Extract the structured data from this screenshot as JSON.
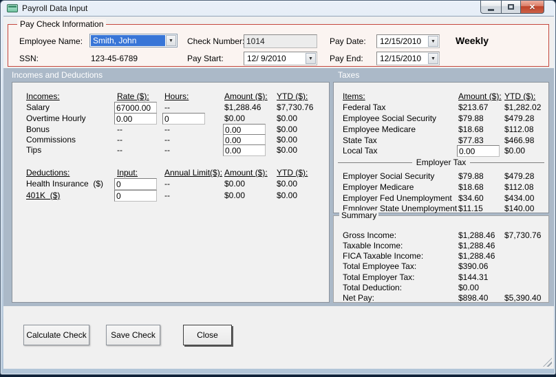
{
  "window": {
    "title": "Payroll Data Input"
  },
  "icons": {
    "close": "✕",
    "dropdown": "▼"
  },
  "colors": {
    "titlebar": "#C9D8E8",
    "band": "#ABB9C8",
    "panel": "#F1F1F1",
    "groupbox_border": "#C4453C",
    "groupbox_bg": "#FBF4F1",
    "selection_blue": "#3875D7",
    "close_red": "#BE4229",
    "window_bg": "#F0F0F0"
  },
  "paycheck_info": {
    "group_label": "Pay Check Information",
    "employee_name_label": "Employee Name:",
    "employee_name_value": "Smith, John",
    "ssn_label": "SSN:",
    "ssn_value": "123-45-6789",
    "check_number_label": "Check Number:",
    "check_number_value": "1014",
    "pay_start_label": "Pay Start:",
    "pay_start_value": "12/ 9/2010",
    "pay_date_label": "Pay Date:",
    "pay_date_value": "12/15/2010",
    "pay_end_label": "Pay End:",
    "pay_end_value": "12/15/2010",
    "frequency": "Weekly"
  },
  "sections": {
    "incomes_deductions_header": "Incomes and Deductions",
    "taxes_header": "Taxes"
  },
  "incomes": {
    "headers": {
      "name": "Incomes:",
      "rate": "Rate ($):",
      "hours": "Hours:",
      "amount": "Amount ($):",
      "ytd": "YTD ($):"
    },
    "rows": [
      {
        "label": "Salary",
        "rate": "67000.00",
        "hours": "--",
        "amount": "$1,288.46",
        "ytd": "$7,730.76"
      },
      {
        "label": "Overtime Hourly",
        "rate": "0.00",
        "hours": "0",
        "amount": "$0.00",
        "ytd": "$0.00"
      },
      {
        "label": "Bonus",
        "rate": "--",
        "hours": "--",
        "amount": "0.00",
        "ytd": "$0.00"
      },
      {
        "label": "Commissions",
        "rate": "--",
        "hours": "--",
        "amount": "0.00",
        "ytd": "$0.00"
      },
      {
        "label": "Tips",
        "rate": "--",
        "hours": "--",
        "amount": "0.00",
        "ytd": "$0.00"
      }
    ]
  },
  "deductions": {
    "headers": {
      "name": "Deductions:",
      "input": "Input:",
      "annual_limit": "Annual Limit($):",
      "amount": "Amount ($):",
      "ytd": "YTD ($):"
    },
    "rows": [
      {
        "label": "Health Insurance  ($)",
        "input": "0",
        "annual_limit": "--",
        "amount": "$0.00",
        "ytd": "$0.00"
      },
      {
        "label": "401K  ($)",
        "input": "0",
        "annual_limit": "--",
        "amount": "$0.00",
        "ytd": "$0.00"
      }
    ]
  },
  "taxes": {
    "headers": {
      "items": "Items:",
      "amount": "Amount ($):",
      "ytd": "YTD ($):"
    },
    "employee_rows": [
      {
        "label": "Federal Tax",
        "amount": "$213.67",
        "ytd": "$1,282.02"
      },
      {
        "label": "Employee Social Security",
        "amount": "$79.88",
        "ytd": "$479.28"
      },
      {
        "label": "Employee Medicare",
        "amount": "$18.68",
        "ytd": "$112.08"
      },
      {
        "label": "State Tax",
        "amount": "$77.83",
        "ytd": "$466.98"
      },
      {
        "label": "Local Tax",
        "amount": "0.00",
        "ytd": "$0.00"
      }
    ],
    "employer_header": "Employer Tax",
    "employer_rows": [
      {
        "label": "Employer Social Security",
        "amount": "$79.88",
        "ytd": "$479.28"
      },
      {
        "label": "Employer Medicare",
        "amount": "$18.68",
        "ytd": "$112.08"
      },
      {
        "label": "Employer Fed Unemployment",
        "amount": "$34.60",
        "ytd": "$434.00"
      },
      {
        "label": "Employer State Unemployment",
        "amount": "$11.15",
        "ytd": "$140.00"
      }
    ]
  },
  "summary": {
    "group_label": "Summary",
    "rows": [
      {
        "label": "Gross Income:",
        "amount": "$1,288.46",
        "ytd": "$7,730.76"
      },
      {
        "label": "Taxable Income:",
        "amount": "$1,288.46",
        "ytd": ""
      },
      {
        "label": "FICA Taxable Income:",
        "amount": "$1,288.46",
        "ytd": ""
      },
      {
        "label": "Total Employee Tax:",
        "amount": "$390.06",
        "ytd": ""
      },
      {
        "label": "Total Employer Tax:",
        "amount": "$144.31",
        "ytd": ""
      },
      {
        "label": "Total Deduction:",
        "amount": "$0.00",
        "ytd": ""
      },
      {
        "label": "Net Pay:",
        "amount": "$898.40",
        "ytd": "$5,390.40"
      }
    ]
  },
  "buttons": {
    "calculate": "Calculate Check",
    "save": "Save Check",
    "close": "Close"
  }
}
